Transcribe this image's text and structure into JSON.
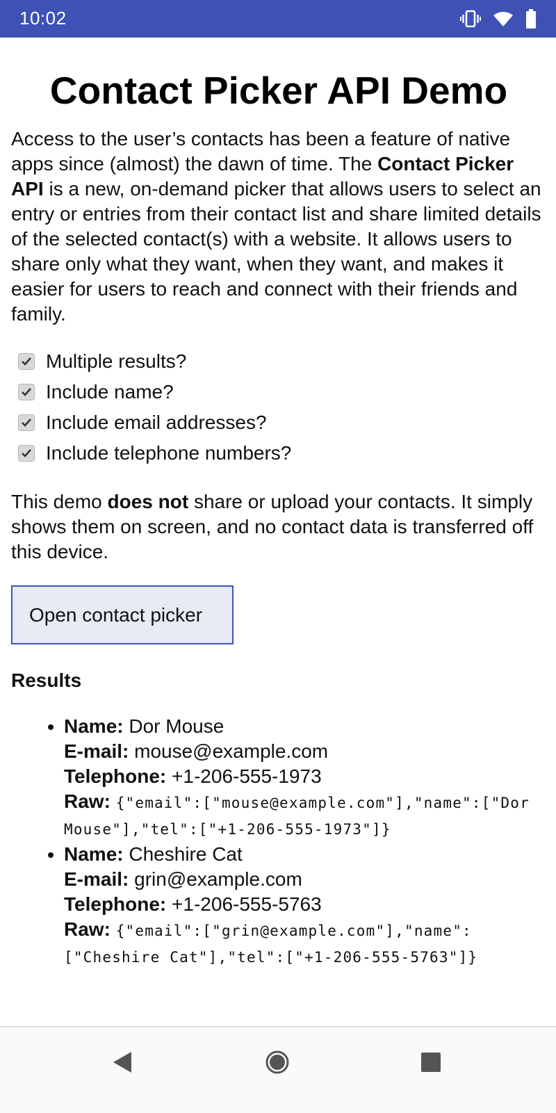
{
  "status_bar": {
    "time": "10:02",
    "icons": [
      "vibrate-icon",
      "wifi-icon",
      "battery-icon"
    ],
    "color": "#3f51b5"
  },
  "page": {
    "title": "Contact Picker API Demo",
    "intro_part1": "Access to the user’s contacts has been a feature of native apps since (almost) the dawn of time. The ",
    "intro_bold": "Contact Picker API",
    "intro_part2": " is a new, on-demand picker that allows users to select an entry or entries from their contact list and share limited details of the selected contact(s) with a website. It allows users to share only what they want, when they want, and makes it easier for users to reach and connect with their friends and family."
  },
  "options": [
    {
      "label": "Multiple results?",
      "checked": true
    },
    {
      "label": "Include name?",
      "checked": true
    },
    {
      "label": "Include email addresses?",
      "checked": true
    },
    {
      "label": "Include telephone numbers?",
      "checked": true
    }
  ],
  "disclaimer": {
    "part1": "This demo ",
    "bold": "does not",
    "part2": " share or upload your contacts. It simply shows them on screen, and no contact data is transferred off this device."
  },
  "button": {
    "label": "Open contact picker"
  },
  "results": {
    "heading": "Results",
    "name_label": "Name:",
    "email_label": "E-mail:",
    "tel_label": "Telephone:",
    "raw_label": "Raw:",
    "items": [
      {
        "name": "Dor Mouse",
        "email": "mouse@example.com",
        "tel": "+1-206-555-1973",
        "raw": "{\"email\":[\"mouse@example.com\"],\"name\":[\"Dor Mouse\"],\"tel\":[\"+1-206-555-1973\"]}"
      },
      {
        "name": "Cheshire Cat",
        "email": "grin@example.com",
        "tel": "+1-206-555-5763",
        "raw": "{\"email\":[\"grin@example.com\"],\"name\":[\"Cheshire Cat\"],\"tel\":[\"+1-206-555-5763\"]}"
      }
    ]
  },
  "nav_bar": {
    "buttons": [
      "back-icon",
      "home-icon",
      "recents-icon"
    ]
  }
}
